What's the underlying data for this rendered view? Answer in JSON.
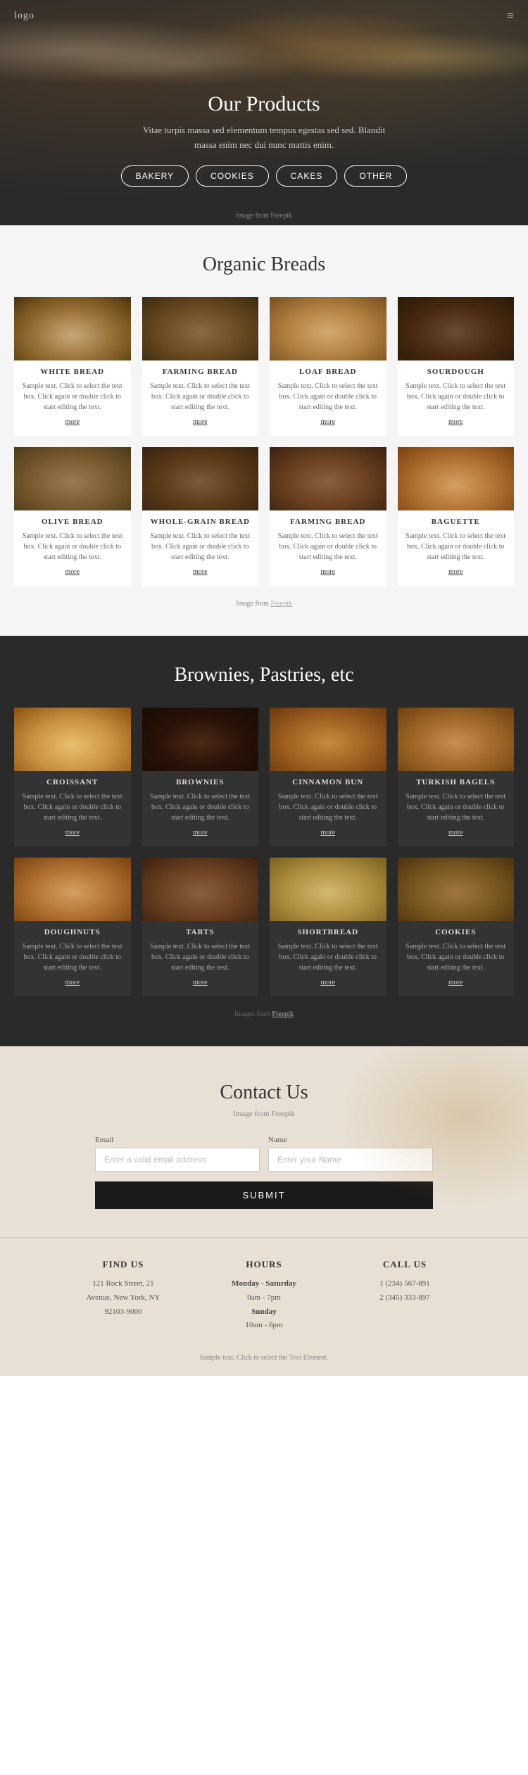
{
  "nav": {
    "logo": "logo",
    "menu_icon": "≡"
  },
  "hero": {
    "title": "Our Products",
    "subtitle": "Vitae turpis massa sed elementum tempus egestas sed sed. Blandit massa enim nec dui nunc mattis enim.",
    "buttons": [
      "BAKERY",
      "COOKIES",
      "CAKES",
      "OTHER"
    ],
    "image_credit": "Image from Freepik"
  },
  "organic_breads": {
    "title": "Organic Breads",
    "image_credit": "Image from",
    "image_link": "Freepik",
    "products": [
      {
        "name": "WHITE BREAD",
        "desc": "Sample text. Click to select the text box. Click again or double click to start editing the text.",
        "more": "more",
        "img_class": "img-white-bread"
      },
      {
        "name": "FARMING BREAD",
        "desc": "Sample text. Click to select the text box. Click again or double click to start editing the text.",
        "more": "more",
        "img_class": "img-farming-bread"
      },
      {
        "name": "LOAF BREAD",
        "desc": "Sample text. Click to select the text box. Click again or double click to start editing the text.",
        "more": "more",
        "img_class": "img-loaf-bread"
      },
      {
        "name": "SOURDOUGH",
        "desc": "Sample text. Click to select the text box. Click again or double click to start editing the text.",
        "more": "more",
        "img_class": "img-sourdough"
      },
      {
        "name": "OLIVE BREAD",
        "desc": "Sample text. Click to select the text box. Click again or double click to start editing the text.",
        "more": "more",
        "img_class": "img-olive-bread"
      },
      {
        "name": "WHOLE-GRAIN BREAD",
        "desc": "Sample text. Click to select the text box. Click again or double click to start editing the text.",
        "more": "more",
        "img_class": "img-whole-grain"
      },
      {
        "name": "FARMING BREAD",
        "desc": "Sample text. Click to select the text box. Click again or double click to start editing the text.",
        "more": "more",
        "img_class": "img-farming-bread2"
      },
      {
        "name": "BAGUETTE",
        "desc": "Sample text. Click to select the text box. Click again or double click to start editing the text.",
        "more": "more",
        "img_class": "img-baguette"
      }
    ]
  },
  "pastries": {
    "title": "Brownies, Pastries, etc",
    "image_credit": "Images from",
    "image_link": "Freepik",
    "products": [
      {
        "name": "CROISSANT",
        "desc": "Sample text. Click to select the text box. Click again or double click to start editing the text.",
        "more": "more",
        "img_class": "img-croissant"
      },
      {
        "name": "BROWNIES",
        "desc": "Sample text. Click to select the text box. Click again or double click to start editing the text.",
        "more": "more",
        "img_class": "img-brownies"
      },
      {
        "name": "CINNAMON BUN",
        "desc": "Sample text. Click to select the text box. Click again or double click to start editing the text.",
        "more": "more",
        "img_class": "img-cinnamon-bun"
      },
      {
        "name": "TURKISH BAGELS",
        "desc": "Sample text. Click to select the text box. Click again or double click to start editing the text.",
        "more": "more",
        "img_class": "img-turkish-bagels"
      },
      {
        "name": "DOUGHNUTS",
        "desc": "Sample text. Click to select the text box. Click again or double click to start editing the text.",
        "more": "more",
        "img_class": "img-doughnuts"
      },
      {
        "name": "TARTS",
        "desc": "Sample text. Click to select the text box. Click again or double click to start editing the text.",
        "more": "more",
        "img_class": "img-tarts"
      },
      {
        "name": "SHORTBREAD",
        "desc": "Sample text. Click to select the text box. Click again or double click to start editing the text.",
        "more": "more",
        "img_class": "img-shortbread"
      },
      {
        "name": "COOKIES",
        "desc": "Sample text. Click to select the text box. Click again or double click to start editing the text.",
        "more": "more",
        "img_class": "img-cookies"
      }
    ]
  },
  "contact": {
    "title": "Contact Us",
    "subtitle": "Image from Freepik",
    "subtitle_link": "Freepik",
    "email_label": "Email",
    "email_placeholder": "Enter a valid email address",
    "name_label": "Name",
    "name_placeholder": "Enter your Name",
    "submit_label": "SUBMIT"
  },
  "footer": {
    "find_us": {
      "title": "FIND US",
      "address_line1": "121 Rock Street, 21",
      "address_line2": "Avenue, New York, NY",
      "address_line3": "92103-9000"
    },
    "hours": {
      "title": "HOURS",
      "weekdays_label": "Monday - Saturday",
      "weekdays_hours": "9am - 7pm",
      "sunday_label": "Sunday",
      "sunday_hours": "10am - 6pm"
    },
    "call_us": {
      "title": "CALL US",
      "phone1": "1 (234) 567-891",
      "phone2": "2 (345) 333-897"
    },
    "sample_text": "Sample text. Click to select the Text Element."
  }
}
